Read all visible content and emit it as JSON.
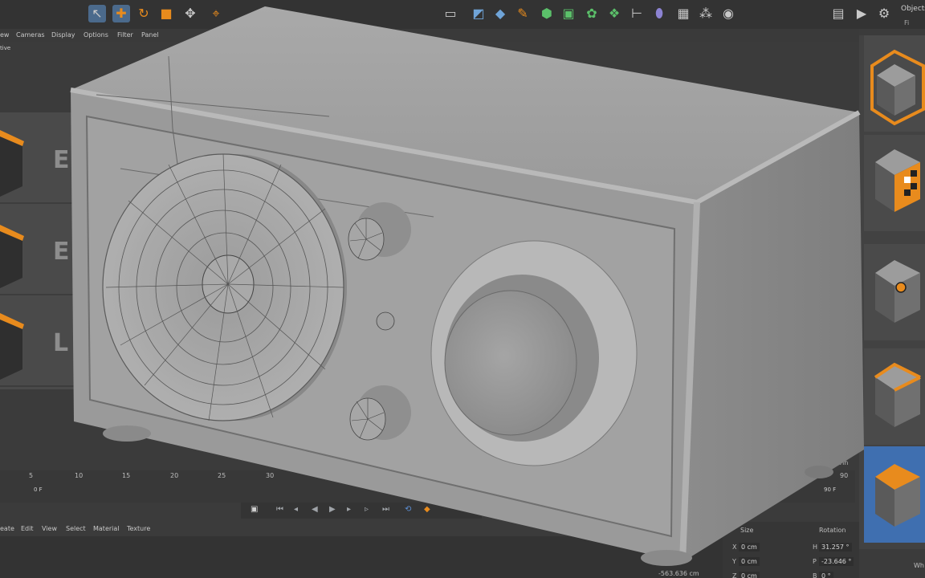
{
  "app": {
    "viewport_label": "tive"
  },
  "toolbar": {
    "icons": [
      "move-icon",
      "add-icon",
      "rotate-icon",
      "scale-icon",
      "axis-icon",
      "coordinate-icon",
      "render-region-icon",
      "render-view-icon",
      "edit-render-icon",
      "cube-icon",
      "pen-icon",
      "subdivision-icon",
      "extrude-icon",
      "generator-icon",
      "array-icon",
      "deformer-icon",
      "field-icon",
      "environment-icon",
      "camera-icon",
      "light-icon",
      "clapper-icon",
      "play-icon",
      "gear-icon"
    ],
    "tabs": {
      "objects": "Objects",
      "fi": "Fi"
    }
  },
  "view_menu": [
    "ew",
    "Cameras",
    "Display",
    "Options",
    "Filter",
    "Panel"
  ],
  "ghost_panel": {
    "letters": [
      "E",
      "E",
      "L"
    ]
  },
  "timeline": {
    "ticks": [
      "5",
      "10",
      "15",
      "20",
      "25",
      "30",
      "90"
    ],
    "start_frame": "0 F",
    "end_frame": "90 F",
    "right_label": "oarin"
  },
  "material_menu": [
    "eate",
    "Edit",
    "View",
    "Select",
    "Material",
    "Texture"
  ],
  "coordinates": {
    "size_header": "Size",
    "rotation_header": "Rotation",
    "rows": [
      {
        "axis": "X",
        "pos": "0 cm",
        "rot_axis": "H",
        "rot": "31.257 °"
      },
      {
        "axis": "Y",
        "pos": "0 cm",
        "rot_axis": "P",
        "rot": "-23.646 °"
      },
      {
        "axis": "Z",
        "pos": "0 cm",
        "rot_axis": "B",
        "rot": "0 °"
      }
    ],
    "z_value": "-563.636 cm",
    "apply": "Wh"
  },
  "colors": {
    "accent_orange": "#e88b1d",
    "selection_blue": "#3f6fb0",
    "model_gray": "#9a9a9a"
  }
}
